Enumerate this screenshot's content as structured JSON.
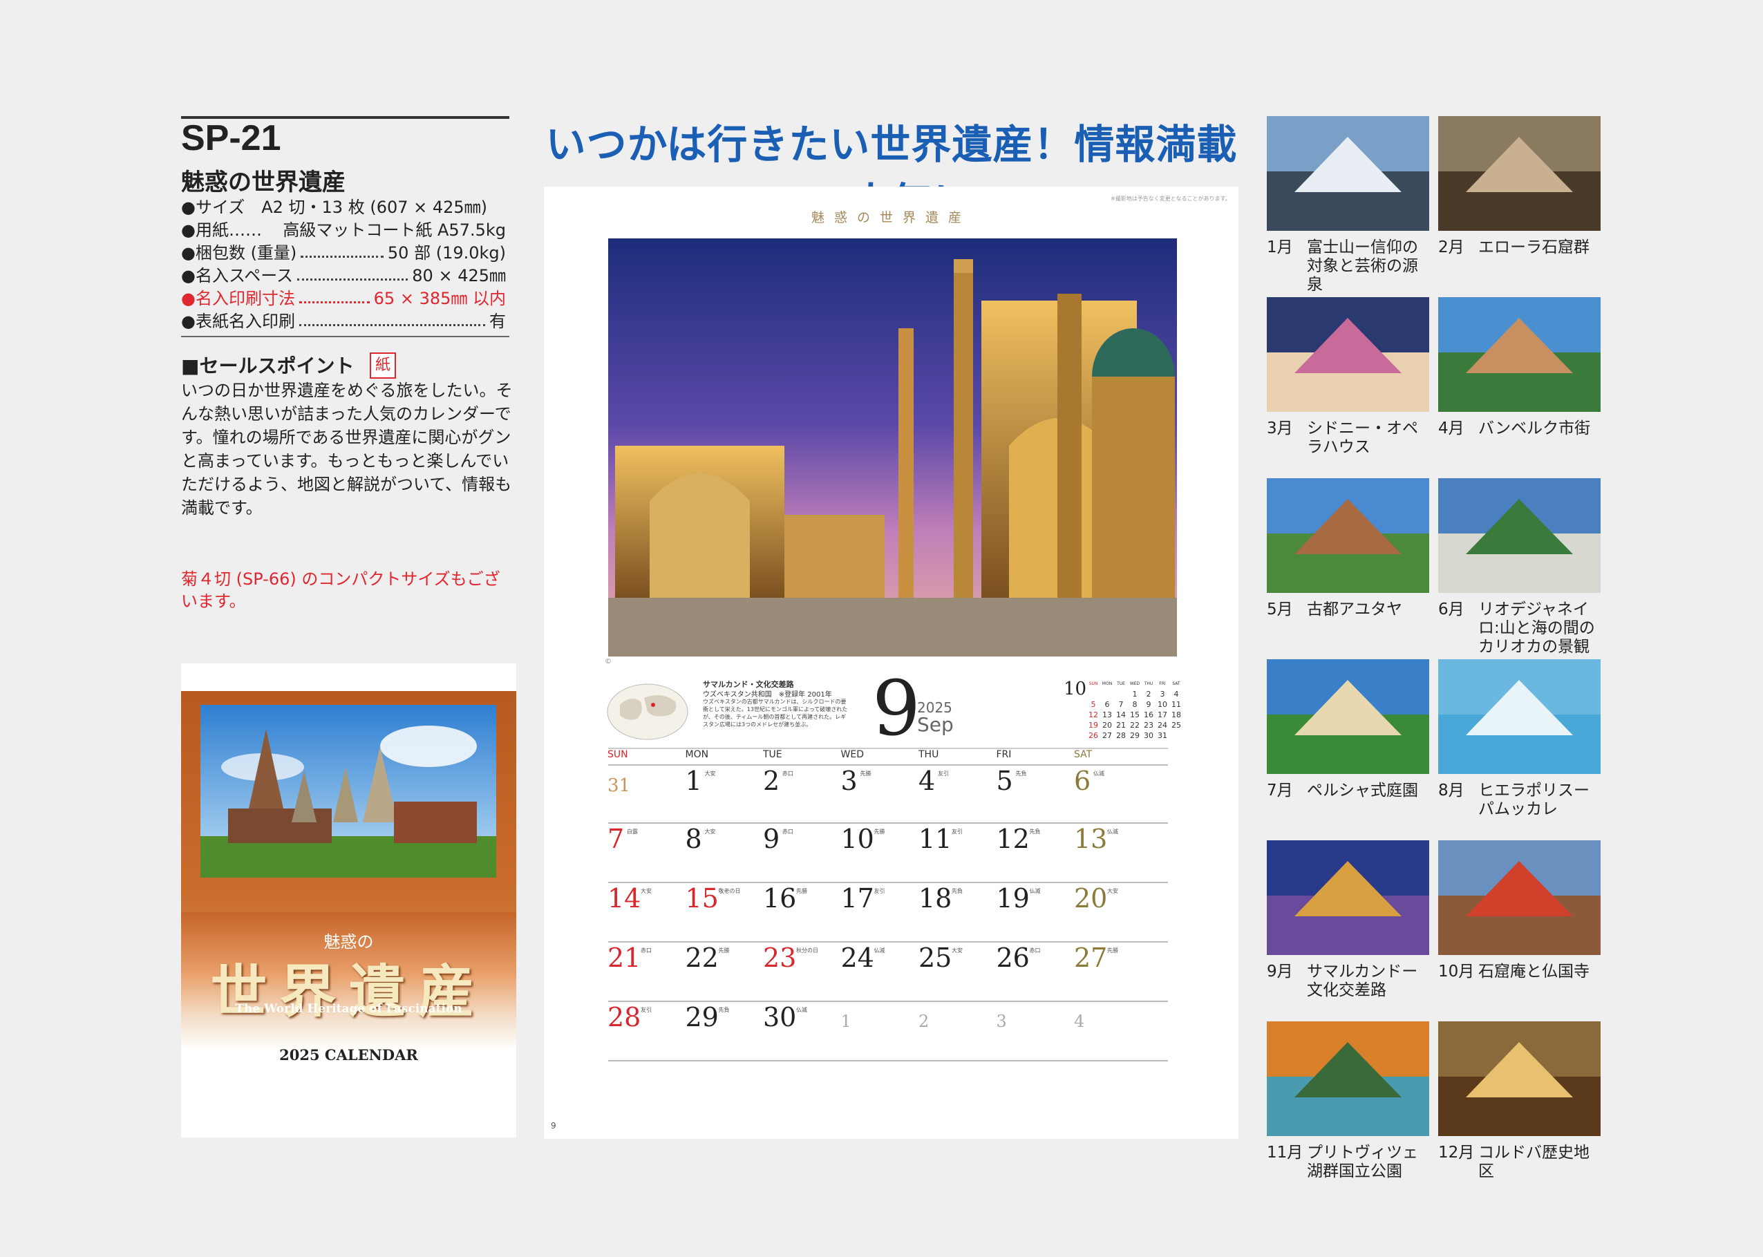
{
  "headline": "いつかは行きたい世界遺産！情報満載で人気に",
  "product": {
    "code": "SP-21",
    "name": "魅惑の世界遺産",
    "specs": [
      {
        "label": "●サイズ　A2 切・13 枚 (607 × 425㎜)",
        "value": ""
      },
      {
        "label": "●用紙……",
        "value": "高級マットコート紙 A57.5kg"
      },
      {
        "label": "●梱包数 (重量)",
        "value": "50 部 (19.0kg)"
      },
      {
        "label": "●名入スペース",
        "value": "80 × 425㎜"
      },
      {
        "label": "●名入印刷寸法",
        "value": "65 × 385㎜ 以内",
        "red": true
      },
      {
        "label": "●表紙名入印刷",
        "value": "有"
      }
    ],
    "sales_title": "■セールスポイント",
    "sales_badge": "紙",
    "sales_text": "いつの日か世界遺産をめぐる旅をしたい。そんな熱い思いが詰まった人気のカレンダーです。憧れの場所である世界遺産に関心がグンと高まっています。もっともっと楽しんでいただけるよう、地図と解説がついて、情報も満載です。",
    "note": "菊４切 (SP-66) のコンパクトサイズもございます。"
  },
  "cover": {
    "subtitle": "魅惑の",
    "title": "世界遺産",
    "english": "The World Heritage of Fascination",
    "year_label": "2025 CALENDAR"
  },
  "page": {
    "brand": "魅惑の世界遺産",
    "tiny": "※撮影地は予告なく変更となることがあります。",
    "copyright": "©",
    "info_title": "サマルカンド・文化交差路",
    "info_sub": "ウズベキスタン共和国　※登録年 2001年",
    "info_text": "ウズベキスタンの古都サマルカンドは、シルクロードの要衝として栄えた。13世紀にモンゴル軍によって破壊されたが、その後、ティムール朝の首都として再建された。レギスタン広場には3つのメドレセが建ち並ぶ。",
    "big_day": "9",
    "year": "2025",
    "month_en": "Sep",
    "next_month": "10",
    "page_num": "9",
    "mini_cal": {
      "head": [
        "SUN",
        "MON",
        "TUE",
        "WED",
        "THU",
        "FRI",
        "SAT"
      ],
      "rows": [
        [
          "",
          "",
          "",
          "1",
          "2",
          "3",
          "4"
        ],
        [
          "5",
          "6",
          "7",
          "8",
          "9",
          "10",
          "11"
        ],
        [
          "12",
          "13",
          "14",
          "15",
          "16",
          "17",
          "18"
        ],
        [
          "19",
          "20",
          "21",
          "22",
          "23",
          "24",
          "25"
        ],
        [
          "26",
          "27",
          "28",
          "29",
          "30",
          "31",
          ""
        ]
      ]
    },
    "week_head": [
      "SUN",
      "MON",
      "TUE",
      "WED",
      "THU",
      "FRI",
      "SAT"
    ],
    "weeks": [
      [
        {
          "d": "31",
          "c": "grey-prev",
          "n": ""
        },
        {
          "d": "1",
          "c": "",
          "n": "大安"
        },
        {
          "d": "2",
          "c": "",
          "n": "赤口"
        },
        {
          "d": "3",
          "c": "",
          "n": "先勝"
        },
        {
          "d": "4",
          "c": "",
          "n": "友引"
        },
        {
          "d": "5",
          "c": "",
          "n": "先負"
        },
        {
          "d": "6",
          "c": "gold",
          "n": "仏滅"
        }
      ],
      [
        {
          "d": "7",
          "c": "red",
          "n": "白露"
        },
        {
          "d": "8",
          "c": "",
          "n": "大安"
        },
        {
          "d": "9",
          "c": "",
          "n": "赤口"
        },
        {
          "d": "10",
          "c": "",
          "n": "先勝"
        },
        {
          "d": "11",
          "c": "",
          "n": "友引"
        },
        {
          "d": "12",
          "c": "",
          "n": "先負"
        },
        {
          "d": "13",
          "c": "gold",
          "n": "仏滅"
        }
      ],
      [
        {
          "d": "14",
          "c": "red",
          "n": "大安"
        },
        {
          "d": "15",
          "c": "red",
          "n": "敬老の日"
        },
        {
          "d": "16",
          "c": "",
          "n": "先勝"
        },
        {
          "d": "17",
          "c": "",
          "n": "友引"
        },
        {
          "d": "18",
          "c": "",
          "n": "先負"
        },
        {
          "d": "19",
          "c": "",
          "n": "仏滅"
        },
        {
          "d": "20",
          "c": "gold",
          "n": "大安"
        }
      ],
      [
        {
          "d": "21",
          "c": "red",
          "n": "赤口"
        },
        {
          "d": "22",
          "c": "",
          "n": "先勝"
        },
        {
          "d": "23",
          "c": "red",
          "n": "秋分の日"
        },
        {
          "d": "24",
          "c": "",
          "n": "仏滅"
        },
        {
          "d": "25",
          "c": "",
          "n": "大安"
        },
        {
          "d": "26",
          "c": "",
          "n": "赤口"
        },
        {
          "d": "27",
          "c": "gold",
          "n": "先勝"
        }
      ],
      [
        {
          "d": "28",
          "c": "red",
          "n": "友引"
        },
        {
          "d": "29",
          "c": "",
          "n": "先負"
        },
        {
          "d": "30",
          "c": "",
          "n": "仏滅"
        },
        {
          "d": "1",
          "c": "grey",
          "n": ""
        },
        {
          "d": "2",
          "c": "grey",
          "n": ""
        },
        {
          "d": "3",
          "c": "grey",
          "n": ""
        },
        {
          "d": "4",
          "c": "grey",
          "n": ""
        }
      ]
    ]
  },
  "months": [
    {
      "mo": "1月",
      "name": "富士山ー信仰の対象と芸術の源泉"
    },
    {
      "mo": "2月",
      "name": "エローラ石窟群"
    },
    {
      "mo": "3月",
      "name": "シドニー・オペラハウス"
    },
    {
      "mo": "4月",
      "name": "バンベルク市街"
    },
    {
      "mo": "5月",
      "name": "古都アユタヤ"
    },
    {
      "mo": "6月",
      "name": "リオデジャネイロ:山と海の間のカリオカの景観"
    },
    {
      "mo": "7月",
      "name": "ペルシャ式庭園"
    },
    {
      "mo": "8月",
      "name": "ヒエラポリスーパムッカレ"
    },
    {
      "mo": "9月",
      "name": "サマルカンドー文化交差路"
    },
    {
      "mo": "10月",
      "name": "石窟庵と仏国寺"
    },
    {
      "mo": "11月",
      "name": "プリトヴィツェ湖群国立公園"
    },
    {
      "mo": "12月",
      "name": "コルドバ歴史地区"
    }
  ]
}
